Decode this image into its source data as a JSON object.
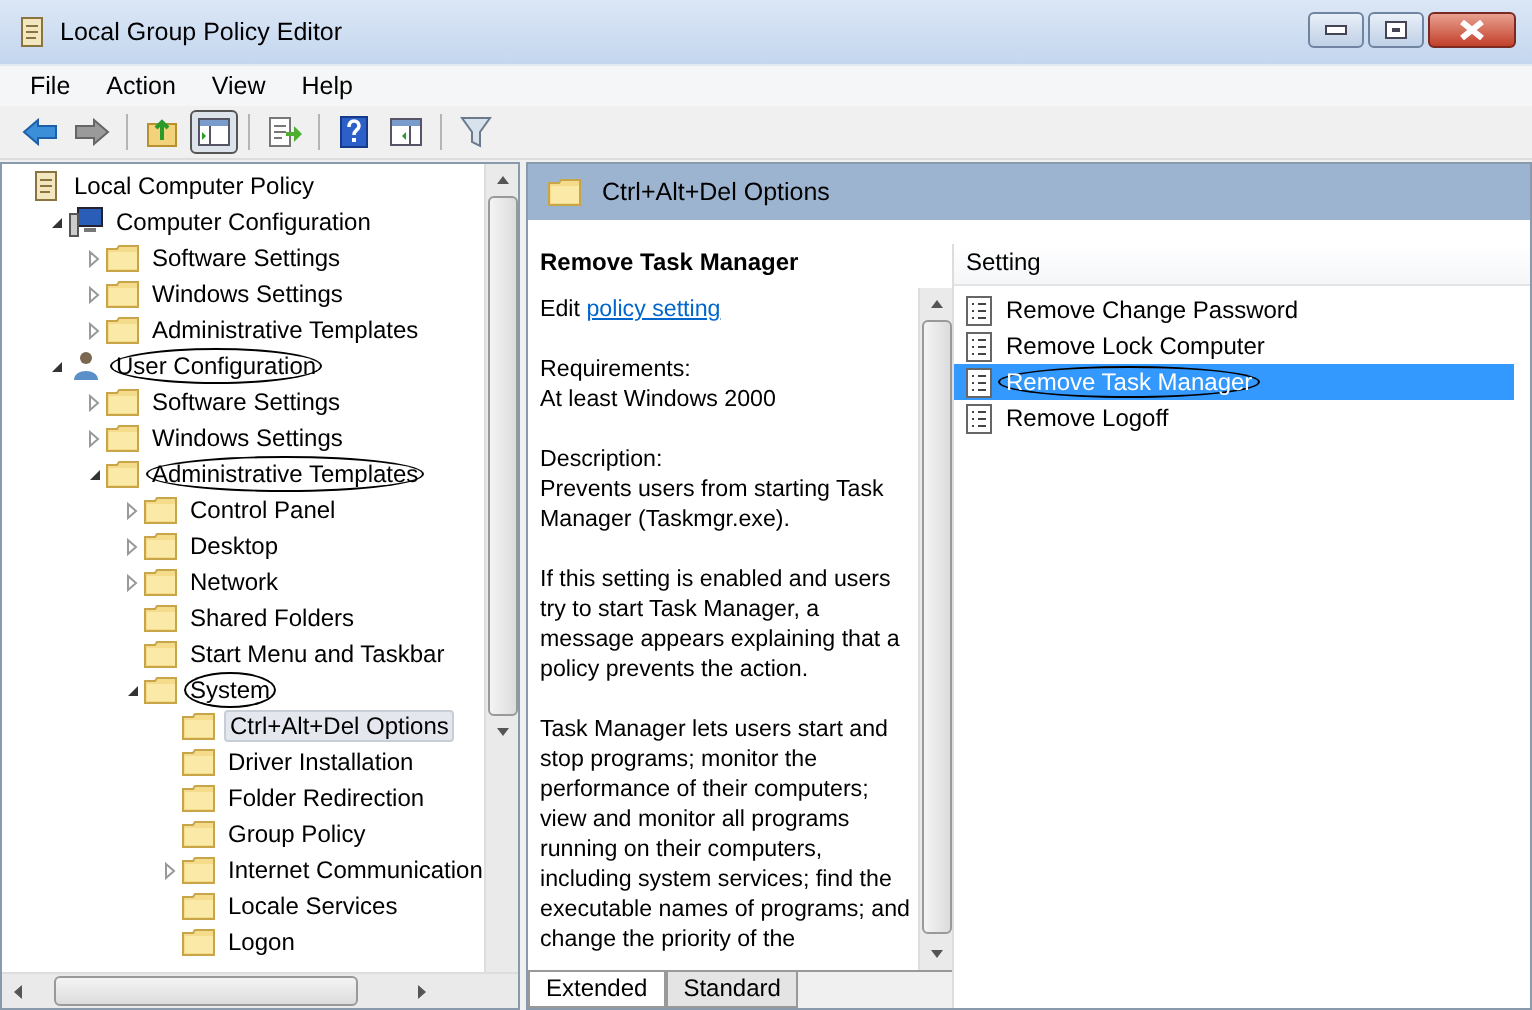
{
  "window": {
    "title": "Local Group Policy Editor"
  },
  "menu": [
    "File",
    "Action",
    "View",
    "Help"
  ],
  "toolbar": [
    [
      {
        "kind": "back",
        "pressed": false
      },
      {
        "kind": "forward",
        "pressed": false
      }
    ],
    [
      {
        "kind": "up",
        "pressed": false
      },
      {
        "kind": "tree",
        "pressed": true
      }
    ],
    [
      {
        "kind": "export",
        "pressed": false
      }
    ],
    [
      {
        "kind": "help",
        "pressed": false
      },
      {
        "kind": "pane",
        "pressed": false
      }
    ],
    [
      {
        "kind": "filter",
        "pressed": false
      }
    ]
  ],
  "tree": {
    "items": [
      {
        "label": "Local Computer Policy",
        "kind": "policy",
        "selected": false,
        "circled": false,
        "children": [
          {
            "label": "Computer Configuration",
            "kind": "computer",
            "expanded": true,
            "selected": false,
            "circled": false,
            "children": [
              {
                "label": "Software Settings",
                "kind": "folder",
                "expanded": false,
                "selected": false,
                "circled": false
              },
              {
                "label": "Windows Settings",
                "kind": "folder",
                "expanded": false,
                "selected": false,
                "circled": false
              },
              {
                "label": "Administrative Templates",
                "kind": "folder",
                "expanded": false,
                "selected": false,
                "circled": false
              }
            ]
          },
          {
            "label": "User Configuration",
            "kind": "user",
            "expanded": true,
            "selected": false,
            "circled": true,
            "children": [
              {
                "label": "Software Settings",
                "kind": "folder",
                "expanded": false,
                "selected": false,
                "circled": false
              },
              {
                "label": "Windows Settings",
                "kind": "folder",
                "expanded": false,
                "selected": false,
                "circled": false
              },
              {
                "label": "Administrative Templates",
                "kind": "folder",
                "expanded": true,
                "selected": false,
                "circled": true,
                "children": [
                  {
                    "label": "Control Panel",
                    "kind": "folder",
                    "expanded": false,
                    "selected": false,
                    "circled": false
                  },
                  {
                    "label": "Desktop",
                    "kind": "folder",
                    "expanded": false,
                    "selected": false,
                    "circled": false
                  },
                  {
                    "label": "Network",
                    "kind": "folder",
                    "expanded": false,
                    "selected": false,
                    "circled": false
                  },
                  {
                    "label": "Shared Folders",
                    "kind": "folder",
                    "selected": false,
                    "circled": false
                  },
                  {
                    "label": "Start Menu and Taskbar",
                    "kind": "folder",
                    "selected": false,
                    "circled": false
                  },
                  {
                    "label": "System",
                    "kind": "folder",
                    "expanded": true,
                    "selected": false,
                    "circled": true,
                    "children": [
                      {
                        "label": "Ctrl+Alt+Del Options",
                        "kind": "folder",
                        "selected": true,
                        "circled": false
                      },
                      {
                        "label": "Driver Installation",
                        "kind": "folder",
                        "selected": false,
                        "circled": false
                      },
                      {
                        "label": "Folder Redirection",
                        "kind": "folder",
                        "selected": false,
                        "circled": false
                      },
                      {
                        "label": "Group Policy",
                        "kind": "folder",
                        "selected": false,
                        "circled": false
                      },
                      {
                        "label": "Internet Communication",
                        "kind": "folder",
                        "expanded": false,
                        "selected": false,
                        "circled": false
                      },
                      {
                        "label": "Locale Services",
                        "kind": "folder",
                        "selected": false,
                        "circled": false
                      },
                      {
                        "label": "Logon",
                        "kind": "folder",
                        "selected": false,
                        "circled": false
                      }
                    ]
                  }
                ]
              }
            ]
          }
        ]
      }
    ]
  },
  "header": {
    "title": "Ctrl+Alt+Del Options"
  },
  "description": {
    "title": "Remove Task Manager",
    "edit_prefix": "Edit",
    "edit_link": "policy setting",
    "blocks": [
      {
        "heading": "Requirements:",
        "text": "At least Windows 2000"
      },
      {
        "heading": "Description:",
        "text": "Prevents users from starting Task Manager (Taskmgr.exe)."
      },
      {
        "text": "If this setting is enabled and users try to start Task Manager, a message appears explaining that a policy prevents the action."
      },
      {
        "text": "Task Manager lets users start and stop programs; monitor the performance of their computers; view and monitor all programs running on their computers, including system services; find the executable names of programs; and change the priority of the"
      }
    ]
  },
  "settings": {
    "column": "Setting",
    "rows": [
      {
        "label": "Remove Change Password",
        "selected": false,
        "circled": false
      },
      {
        "label": "Remove Lock Computer",
        "selected": false,
        "circled": false
      },
      {
        "label": "Remove Task Manager",
        "selected": true,
        "circled": true
      },
      {
        "label": "Remove Logoff",
        "selected": false,
        "circled": false
      }
    ]
  },
  "tabs": [
    {
      "label": "Extended",
      "selected": true
    },
    {
      "label": "Standard",
      "selected": false
    }
  ]
}
